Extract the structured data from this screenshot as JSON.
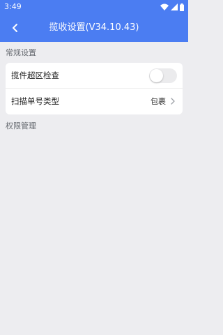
{
  "status_bar": {
    "time": "3:49",
    "icons": [
      "wifi-icon",
      "signal-icon",
      "battery-icon"
    ]
  },
  "app_bar": {
    "title": "揽收设置(V34.10.43)",
    "back_icon": "chevron-left-icon"
  },
  "sections": {
    "general": {
      "header": "常规设置",
      "items": [
        {
          "label": "揽件超区检查",
          "control": "toggle",
          "enabled": false
        },
        {
          "label": "扫描单号类型",
          "value": "包裹",
          "control": "chevron"
        }
      ]
    },
    "permissions": {
      "header": "权限管理"
    }
  },
  "colors": {
    "primary": "#4b7df2",
    "background": "#ededf0",
    "card": "#ffffff",
    "toggle_off": "#ebebed"
  }
}
